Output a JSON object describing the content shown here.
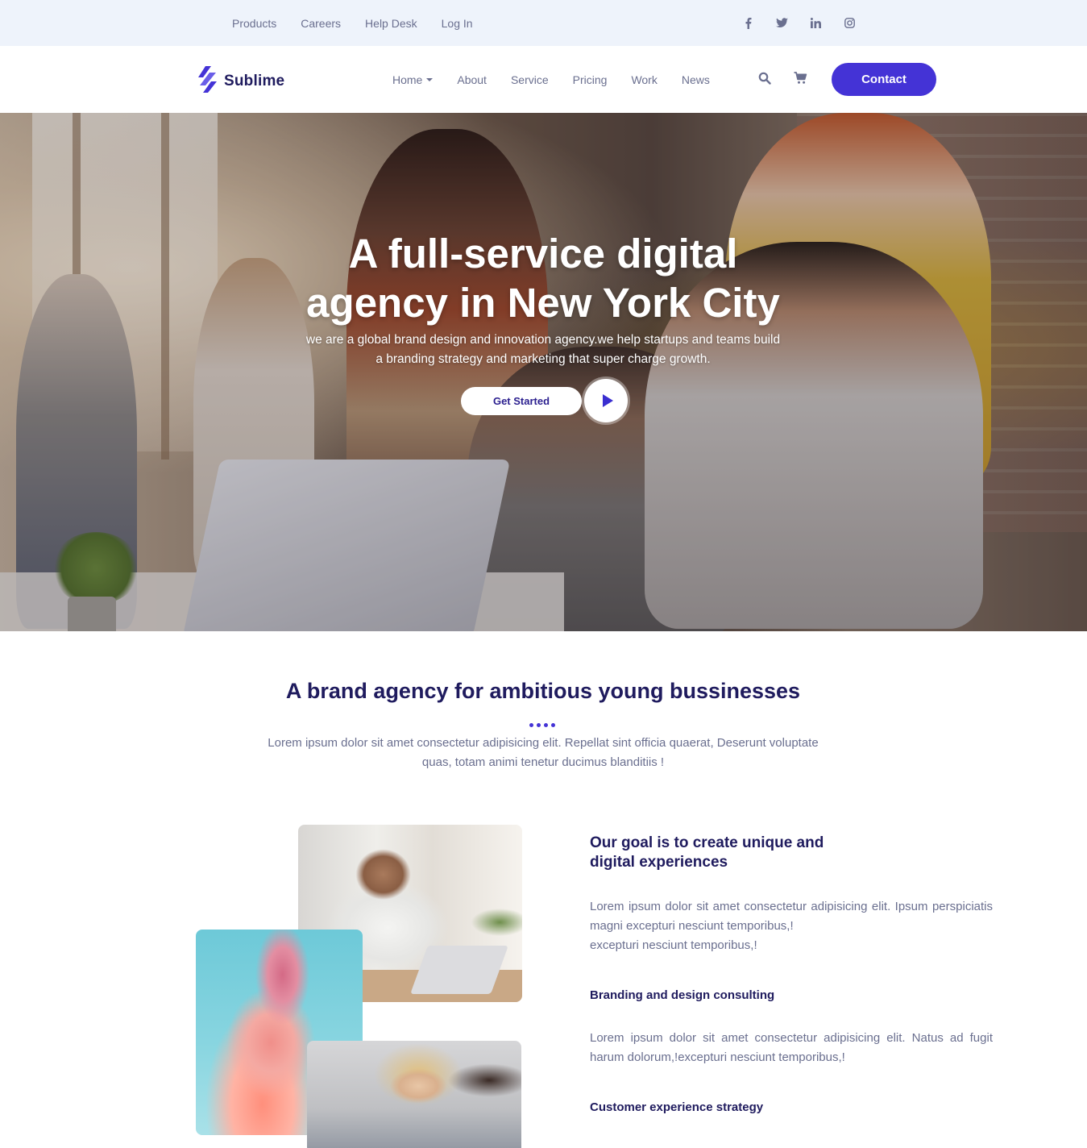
{
  "topbar": {
    "links": [
      "Products",
      "Careers",
      "Help Desk",
      "Log In"
    ],
    "social_icons": [
      "facebook-icon",
      "twitter-icon",
      "linkedin-icon",
      "instagram-icon"
    ]
  },
  "navbar": {
    "brand": "Sublime",
    "items": [
      "Home",
      "About",
      "Service",
      "Pricing",
      "Work",
      "News"
    ],
    "contact_label": "Contact",
    "accent_color": "#4433d6"
  },
  "hero": {
    "title_line1": "A full-service digital",
    "title_line2": "agency in New York City",
    "subtitle": "we are a global brand design and innovation agency.we help startups and teams build a branding strategy and marketing that super charge growth.",
    "cta_label": "Get Started"
  },
  "about": {
    "title": "A brand agency for ambitious young bussinesses",
    "subtitle": "Lorem ipsum dolor sit amet consectetur adipisicing elit. Repellat sint officia quaerat, Deserunt voluptate quas, totam animi tenetur ducimus blanditiis !"
  },
  "goal": {
    "title": "Our goal is to create unique and digital experiences",
    "text": "Lorem ipsum dolor sit amet consectetur adipisicing elit. Ipsum perspiciatis magni excepturi nesciunt temporibus,!",
    "text_line2": "excepturi nesciunt temporibus,!",
    "branding_title": "Branding and design consulting",
    "branding_text": "Lorem ipsum dolor sit amet consectetur adipisicing elit. Natus ad fugit harum dolorum,!excepturi nesciunt temporibus,!",
    "customer_title": "Customer experience strategy"
  }
}
